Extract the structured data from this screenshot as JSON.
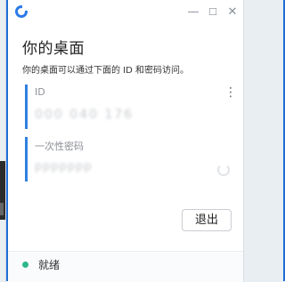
{
  "window": {
    "minimize_glyph": "—",
    "maximize_glyph": "☐",
    "close_glyph": "✕",
    "accent_color": "#1e6dd6"
  },
  "header": {
    "title": "你的桌面",
    "subtitle": "你的桌面可以通过下面的 ID 和密码访问。"
  },
  "id_field": {
    "label": "ID",
    "value": "000 040 176",
    "menu_icon": "more-vert-icon"
  },
  "password_field": {
    "label": "一次性密码",
    "value": "ppppppp",
    "refresh_icon": "refresh-icon"
  },
  "actions": {
    "logout_label": "退出"
  },
  "status": {
    "text": "就绪",
    "color": "#2db88a"
  }
}
